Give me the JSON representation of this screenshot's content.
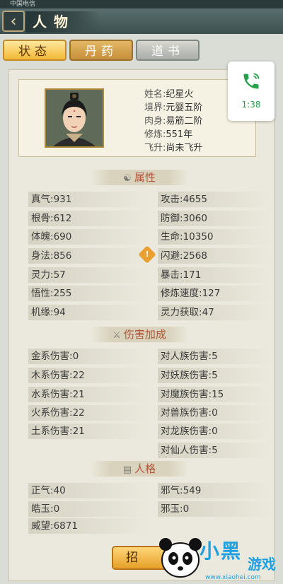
{
  "status_bar": {
    "carrier": "中国电信"
  },
  "header": {
    "title": "人物",
    "back_icon": "chevron-left-icon"
  },
  "tabs": [
    {
      "label": "状态",
      "active": true
    },
    {
      "label": "丹药",
      "active": false
    },
    {
      "label": "道书",
      "active": false
    }
  ],
  "call_widget": {
    "time": "1:38",
    "icon": "phone-icon",
    "color": "#27a04a"
  },
  "profile": {
    "lines": [
      {
        "label": "姓名:",
        "value": "纪星火"
      },
      {
        "label": "境界:",
        "value": "元婴五阶"
      },
      {
        "label": "肉身:",
        "value": "易筋二阶"
      },
      {
        "label": "修炼:",
        "value": "551年"
      },
      {
        "label": "飞升:",
        "value": "尚未飞升"
      }
    ]
  },
  "attributes": {
    "title": "属性",
    "left": [
      {
        "label": "真气:",
        "value": "931"
      },
      {
        "label": "根骨:",
        "value": "612"
      },
      {
        "label": "体魄:",
        "value": "690"
      },
      {
        "label": "身法:",
        "value": "856"
      },
      {
        "label": "灵力:",
        "value": "57"
      },
      {
        "label": "悟性:",
        "value": "255"
      },
      {
        "label": "机缘:",
        "value": "94"
      }
    ],
    "right": [
      {
        "label": "攻击:",
        "value": "4655"
      },
      {
        "label": "防御:",
        "value": "3060"
      },
      {
        "label": "生命:",
        "value": "10350"
      },
      {
        "label": "闪避:",
        "value": "2568"
      },
      {
        "label": "暴击:",
        "value": "171"
      },
      {
        "label": "修炼速度:",
        "value": "127"
      },
      {
        "label": "灵力获取:",
        "value": "47"
      }
    ]
  },
  "damage_bonus": {
    "title": "伤害加成",
    "left": [
      {
        "label": "金系伤害:",
        "value": "0"
      },
      {
        "label": "木系伤害:",
        "value": "22"
      },
      {
        "label": "水系伤害:",
        "value": "21"
      },
      {
        "label": "火系伤害:",
        "value": "22"
      },
      {
        "label": "土系伤害:",
        "value": "21"
      }
    ],
    "right": [
      {
        "label": "对人族伤害:",
        "value": "5"
      },
      {
        "label": "对妖族伤害:",
        "value": "5"
      },
      {
        "label": "对魔族伤害:",
        "value": "15"
      },
      {
        "label": "对兽族伤害:",
        "value": "0"
      },
      {
        "label": "对龙族伤害:",
        "value": "0"
      },
      {
        "label": "对仙人伤害:",
        "value": "5"
      }
    ]
  },
  "personality": {
    "title": "人格",
    "left": [
      {
        "label": "正气:",
        "value": "40"
      },
      {
        "label": "皓玉:",
        "value": "0"
      },
      {
        "label": "威望:",
        "value": "6871"
      }
    ],
    "right": [
      {
        "label": "邪气:",
        "value": "549"
      },
      {
        "label": "邪玉:",
        "value": "0"
      }
    ]
  },
  "bottom_button": {
    "label": "招"
  },
  "watermark": {
    "text": "小黑",
    "sub": "游戏",
    "url": "www.xiaohei.com"
  }
}
